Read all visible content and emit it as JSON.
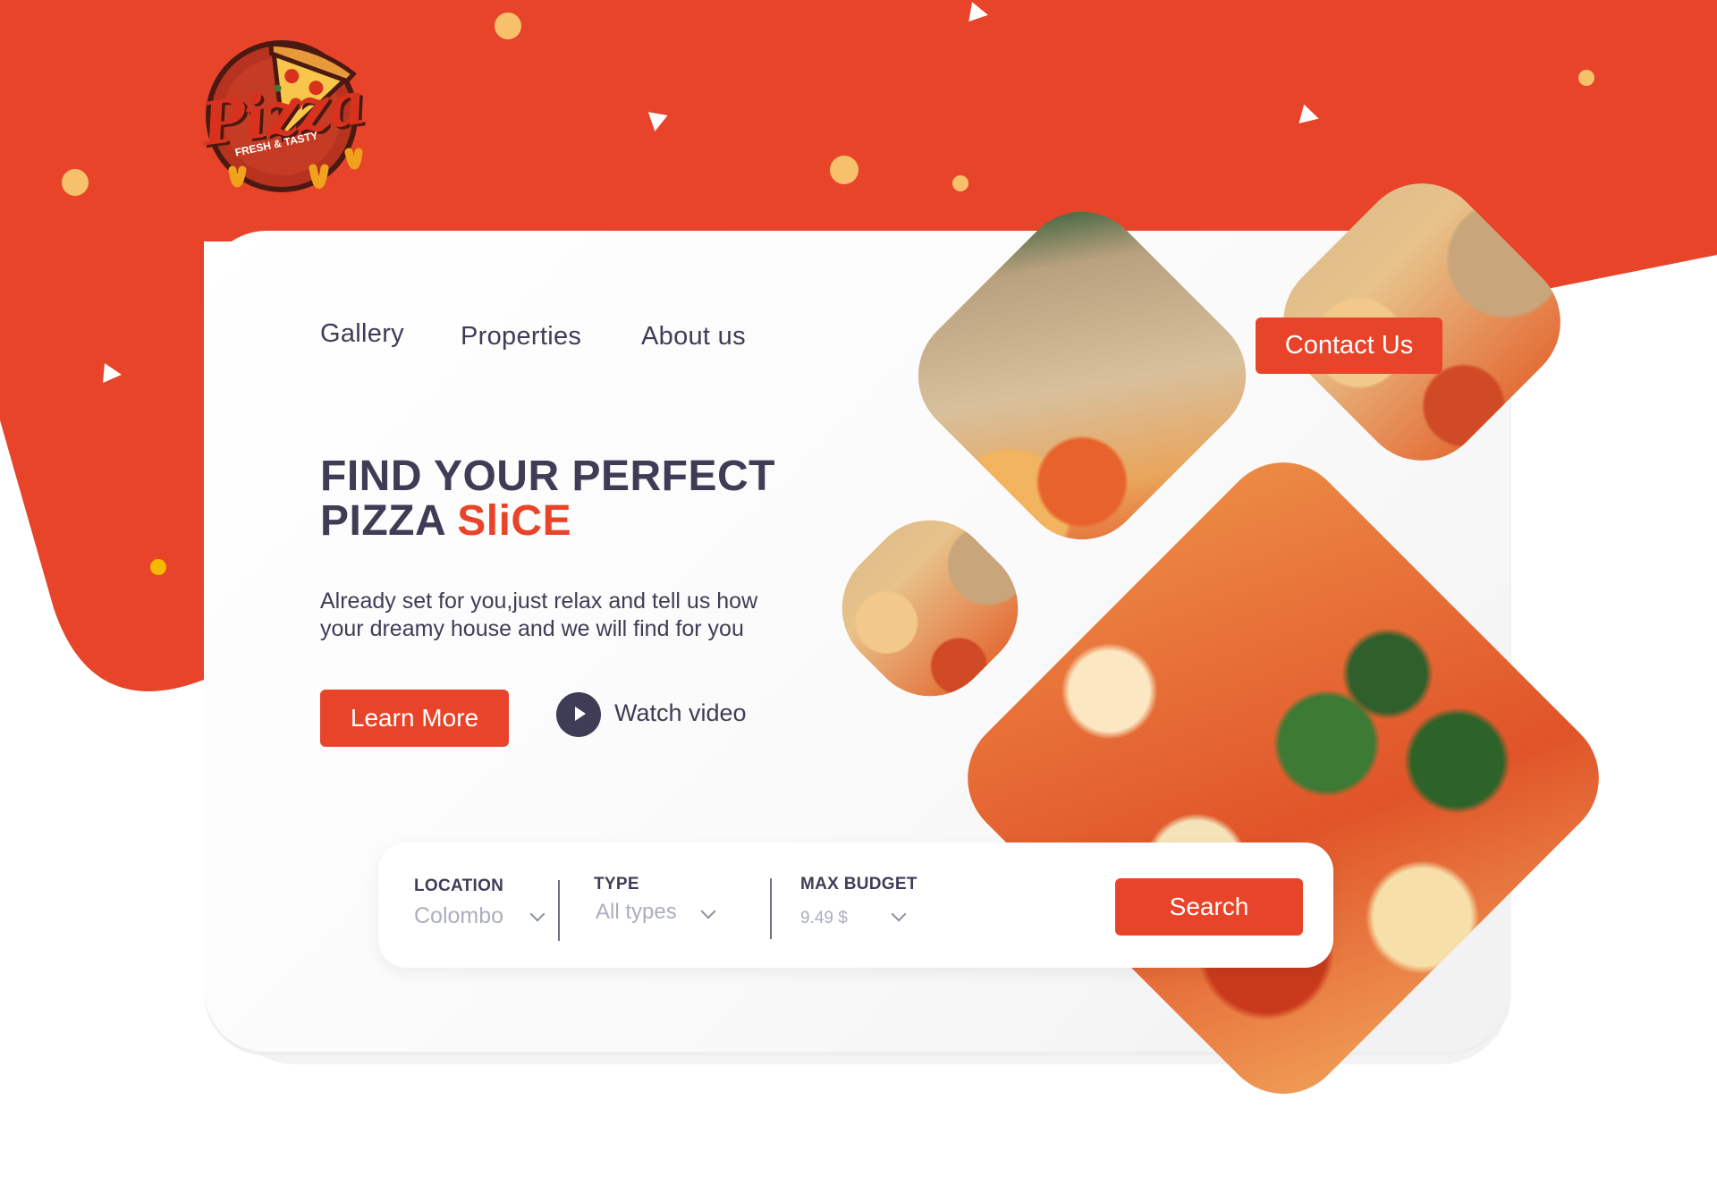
{
  "logo": {
    "word": "Pizza",
    "tagline": "FRESH & TASTY"
  },
  "nav": {
    "items": [
      {
        "label": "Gallery"
      },
      {
        "label": "Properties"
      },
      {
        "label": "About us"
      }
    ],
    "contact_label": "Contact Us"
  },
  "hero": {
    "title_line1": "FIND YOUR PERFECT",
    "title_line2_prefix": "PIZZA",
    "title_line2_accent": "SliCE",
    "description": "Already set for you,just relax and tell us how your dreamy house and we will find for you",
    "learn_more_label": "Learn More",
    "watch_video_label": "Watch video"
  },
  "search": {
    "location": {
      "label": "LOCATION",
      "value": "Colombo"
    },
    "type": {
      "label": "TYPE",
      "value": "All types"
    },
    "budget": {
      "label": "MAX BUDGET",
      "value": "9.49 $"
    },
    "button_label": "Search"
  },
  "colors": {
    "brand": "#e8442a",
    "text_dark": "#3f3d56",
    "muted": "#a9afbd",
    "confetti_yellow": "#f6c16a"
  },
  "icons": [
    "play-icon",
    "chevron-down-icon",
    "pizza-slice-logo-icon"
  ]
}
